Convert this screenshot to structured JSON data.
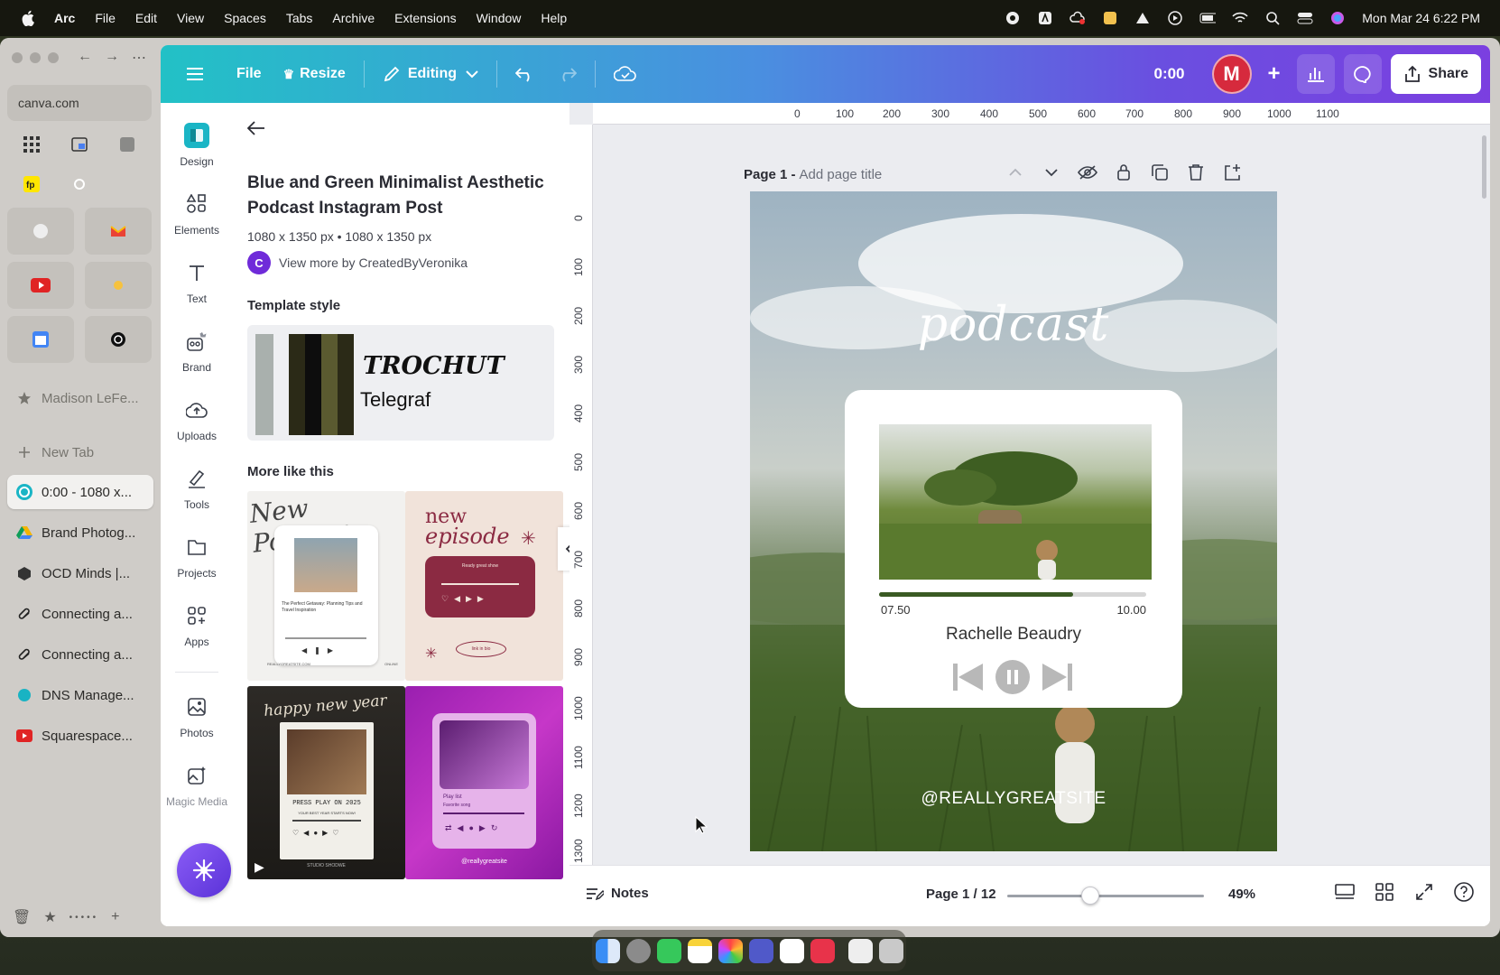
{
  "menubar": {
    "app_name": "Arc",
    "items": [
      "File",
      "Edit",
      "View",
      "Spaces",
      "Tabs",
      "Archive",
      "Extensions",
      "Window",
      "Help"
    ],
    "clock": "Mon Mar 24  6:22 PM"
  },
  "arc": {
    "url": "canva.com",
    "pinned": "Madison LeFe...",
    "new_tab": "New Tab",
    "tabs": [
      {
        "label": "0:00 - 1080 x...",
        "icon": "canva-icon",
        "color": "#1ab5c5"
      },
      {
        "label": "Brand Photog...",
        "icon": "drive-icon",
        "color": "#f4b400"
      },
      {
        "label": "OCD Minds |...",
        "icon": "cube-icon",
        "color": "#333333"
      },
      {
        "label": "Connecting a...",
        "icon": "squarespace-icon",
        "color": "#222222"
      },
      {
        "label": "Connecting a...",
        "icon": "squarespace-icon",
        "color": "#222222"
      },
      {
        "label": "DNS Manage...",
        "icon": "globe-icon",
        "color": "#19b3c3"
      },
      {
        "label": "Squarespace...",
        "icon": "youtube-icon",
        "color": "#e02424"
      }
    ]
  },
  "canva": {
    "toolbar": {
      "file": "File",
      "resize": "Resize",
      "editing": "Editing",
      "timer": "0:00",
      "avatar": "M",
      "share": "Share"
    },
    "rail": [
      {
        "label": "Design",
        "icon": "design-icon"
      },
      {
        "label": "Elements",
        "icon": "elements-icon"
      },
      {
        "label": "Text",
        "icon": "text-icon"
      },
      {
        "label": "Brand",
        "icon": "brand-icon"
      },
      {
        "label": "Uploads",
        "icon": "uploads-icon"
      },
      {
        "label": "Tools",
        "icon": "tools-icon"
      },
      {
        "label": "Projects",
        "icon": "projects-icon"
      },
      {
        "label": "Apps",
        "icon": "apps-icon"
      },
      {
        "label": "Photos",
        "icon": "photos-icon"
      },
      {
        "label": "Magic Media",
        "icon": "magic-media-icon"
      }
    ],
    "panel": {
      "title": "Blue and Green Minimalist Aesthetic Podcast Instagram Post",
      "dims": "1080 x 1350 px • 1080 x 1350 px",
      "creator_initial": "C",
      "creator_text": "View more by CreatedByVeronika",
      "style_label": "Template style",
      "font_display": "TROCHUT",
      "font_body": "Telegraf",
      "more_label": "More like this",
      "swatches": [
        "#a9b0ad",
        "#2b2a17",
        "#0d0d0d",
        "#5a5a30"
      ],
      "thumbs": [
        {
          "title": "New Podcast",
          "subtitle": "The Perfect Getaway: Planning Tips and Travel Inspiration",
          "footer_left": "REALLYGREATSITE.COM",
          "footer_right": "ONLINE"
        },
        {
          "title_top": "new",
          "title_bottom": "episode",
          "card_text": "Ready great show",
          "pill": "link in bio"
        },
        {
          "title": "happy new year",
          "caption": "PRESS PLAY ON 2025",
          "subcaption": "YOUR BEST YEAR STARTS NOW!",
          "footer": "STUDIO SHODWE"
        },
        {
          "title": "Play list",
          "subtitle": "Favorite song",
          "handle": "@reallygreatsite"
        }
      ]
    },
    "rulers": {
      "h": [
        "0",
        "100",
        "200",
        "300",
        "400",
        "500",
        "600",
        "700",
        "800",
        "900",
        "1000",
        "1100"
      ],
      "v": [
        "0",
        "100",
        "200",
        "300",
        "400",
        "500",
        "600",
        "700",
        "800",
        "900",
        "1000",
        "1100",
        "1200",
        "1300"
      ]
    },
    "page": {
      "label": "Page 1 -",
      "title_placeholder": "Add page title"
    },
    "design": {
      "heading": "podcast",
      "time_start": "07.50",
      "time_end": "10.00",
      "progress": 0.725,
      "artist": "Rachelle Beaudry",
      "handle": "@REALLYGREATSITE"
    },
    "bottom": {
      "notes": "Notes",
      "page_info": "Page 1 / 12",
      "zoom": "49%",
      "zoom_level": 0.42
    }
  }
}
